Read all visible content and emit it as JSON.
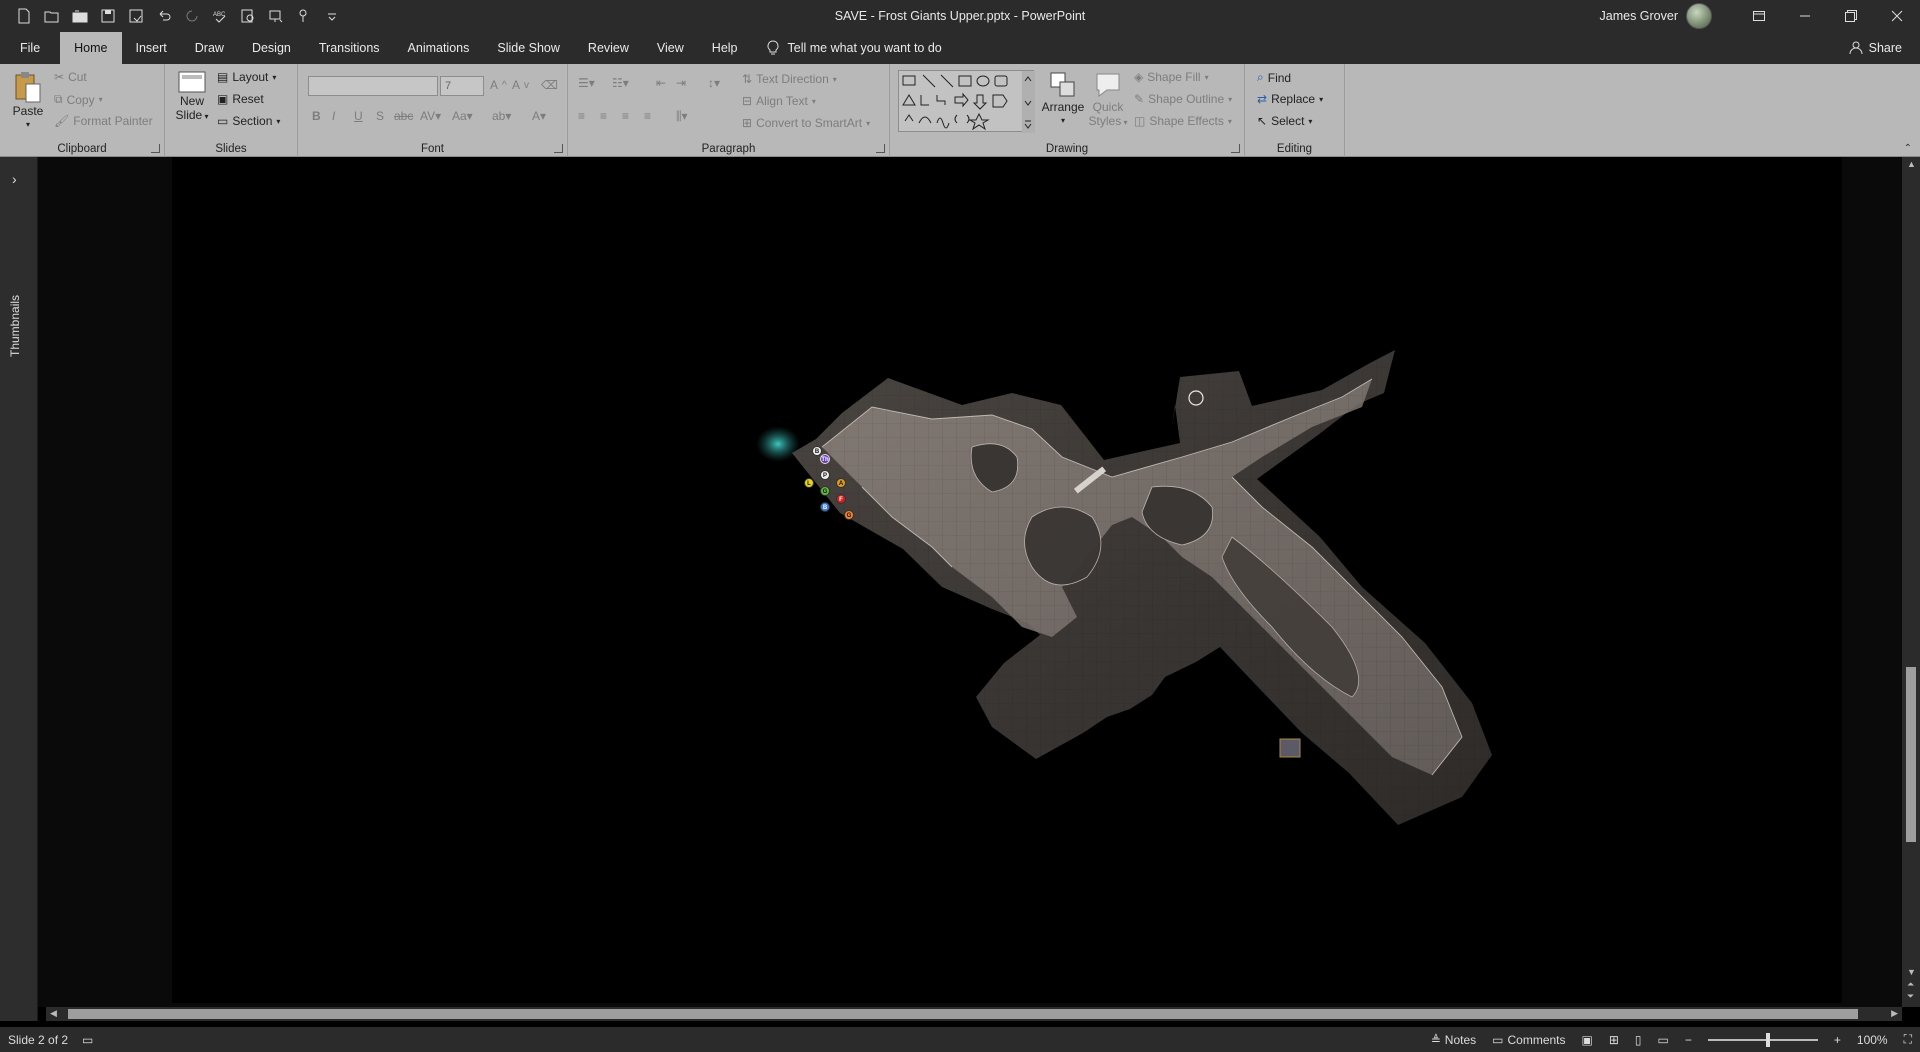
{
  "window": {
    "title": "SAVE - Frost Giants Upper.pptx  -  PowerPoint",
    "user": "James Grover"
  },
  "tabs": [
    "File",
    "Home",
    "Insert",
    "Draw",
    "Design",
    "Transitions",
    "Animations",
    "Slide Show",
    "Review",
    "View",
    "Help"
  ],
  "tell_me": "Tell me what you want to do",
  "share_label": "Share",
  "ribbon": {
    "clipboard": {
      "label": "Clipboard",
      "paste": "Paste",
      "cut": "Cut",
      "copy": "Copy",
      "format_painter": "Format Painter"
    },
    "slides": {
      "label": "Slides",
      "new_slide": "New",
      "new_slide_2": "Slide",
      "layout": "Layout",
      "reset": "Reset",
      "section": "Section"
    },
    "font": {
      "label": "Font",
      "font_name": "",
      "font_size": "7"
    },
    "paragraph": {
      "label": "Paragraph",
      "text_direction": "Text Direction",
      "align_text": "Align Text",
      "convert_smartart": "Convert to SmartArt"
    },
    "drawing": {
      "label": "Drawing",
      "arrange": "Arrange",
      "quick_styles": "Quick",
      "quick_styles_2": "Styles",
      "shape_fill": "Shape Fill",
      "shape_outline": "Shape Outline",
      "shape_effects": "Shape Effects"
    },
    "editing": {
      "label": "Editing",
      "find": "Find",
      "replace": "Replace",
      "select": "Select"
    }
  },
  "thumbnails_label": "Thumbnails",
  "tokens": [
    "B",
    "Th",
    "P",
    "L",
    "A",
    "G",
    "F",
    "B",
    "G"
  ],
  "status": {
    "slide_count": "Slide 2 of 2",
    "notes": "Notes",
    "comments": "Comments",
    "zoom": "100%"
  }
}
